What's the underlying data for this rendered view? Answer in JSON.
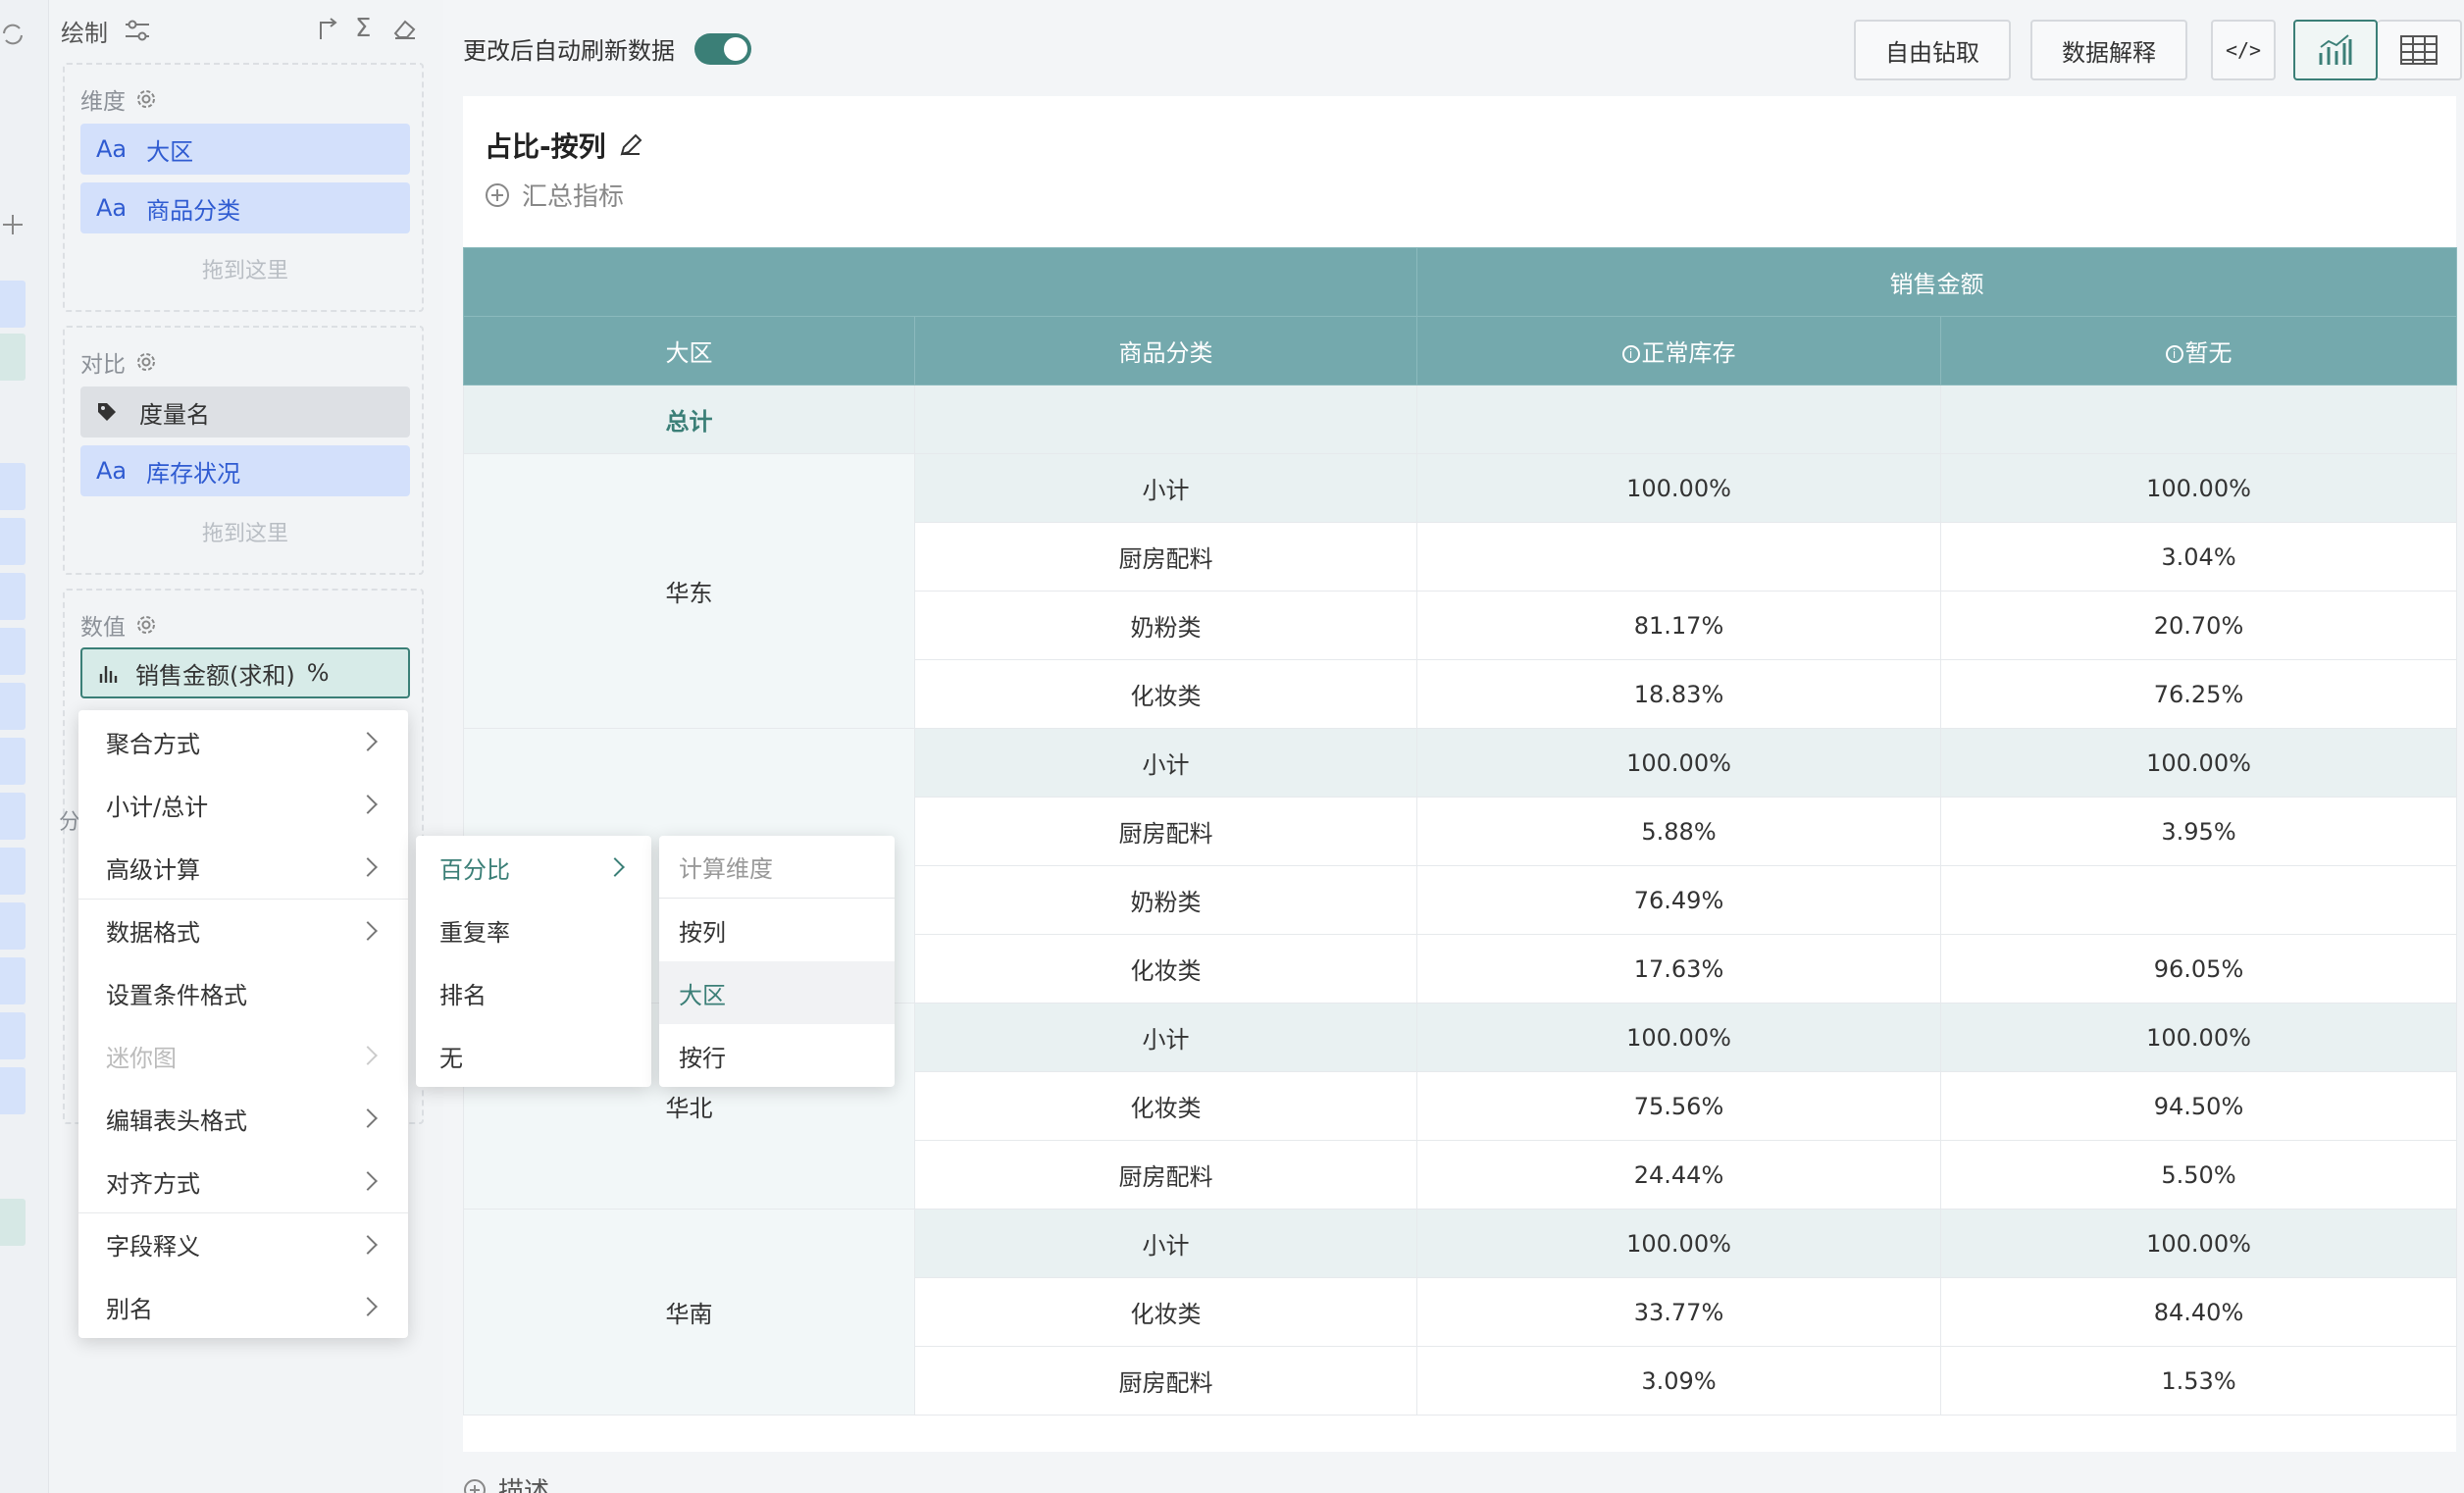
{
  "panel": {
    "title": "绘制",
    "dimensions": {
      "title": "维度",
      "fields": [
        "大区",
        "商品分类"
      ],
      "drop_hint": "拖到这里"
    },
    "compare": {
      "title": "对比",
      "measure_name": "度量名",
      "fields": [
        "库存状况"
      ],
      "drop_hint": "拖到这里"
    },
    "values": {
      "title": "数值",
      "field": "销售金额(求和)",
      "percent_mark": "%"
    },
    "hidden_label": "分",
    "field_type_label": "Aa"
  },
  "menu": {
    "items": [
      "聚合方式",
      "小计/总计",
      "高级计算",
      "数据格式",
      "设置条件格式",
      "迷你图",
      "编辑表头格式",
      "对齐方式",
      "字段释义",
      "别名"
    ]
  },
  "submenu": {
    "items": [
      "百分比",
      "重复率",
      "排名",
      "无"
    ]
  },
  "calc_menu": {
    "header": "计算维度",
    "items": [
      "按列",
      "大区",
      "按行"
    ]
  },
  "topbar": {
    "auto_refresh_label": "更改后自动刷新数据",
    "auto_refresh_on": true,
    "drill_button": "自由钻取",
    "explain_button": "数据解释",
    "code_button": "</>"
  },
  "card": {
    "title": "占比-按列",
    "add_summary": "汇总指标",
    "describe": "描述"
  },
  "table": {
    "top_header": "销售金额",
    "col_headers": [
      "大区",
      "商品分类",
      "正常库存",
      "暂无"
    ],
    "total_label": "总计",
    "groups": [
      {
        "region": "华东",
        "rows": [
          [
            "小计",
            "100.00%",
            "100.00%"
          ],
          [
            "厨房配料",
            "",
            "3.04%"
          ],
          [
            "奶粉类",
            "81.17%",
            "20.70%"
          ],
          [
            "化妆类",
            "18.83%",
            "76.25%"
          ]
        ]
      },
      {
        "region": "",
        "rows": [
          [
            "小计",
            "100.00%",
            "100.00%"
          ],
          [
            "厨房配料",
            "5.88%",
            "3.95%"
          ],
          [
            "奶粉类",
            "76.49%",
            ""
          ],
          [
            "化妆类",
            "17.63%",
            "96.05%"
          ]
        ]
      },
      {
        "region": "华北",
        "rows": [
          [
            "小计",
            "100.00%",
            "100.00%"
          ],
          [
            "化妆类",
            "75.56%",
            "94.50%"
          ],
          [
            "厨房配料",
            "24.44%",
            "5.50%"
          ]
        ]
      },
      {
        "region": "华南",
        "rows": [
          [
            "小计",
            "100.00%",
            "100.00%"
          ],
          [
            "化妆类",
            "33.77%",
            "84.40%"
          ],
          [
            "厨房配料",
            "3.09%",
            "1.53%"
          ]
        ]
      }
    ]
  },
  "colors": {
    "accent": "#3b7f77",
    "header_bg": "#74a9ad",
    "dim_pill": "#d3e0fb"
  }
}
